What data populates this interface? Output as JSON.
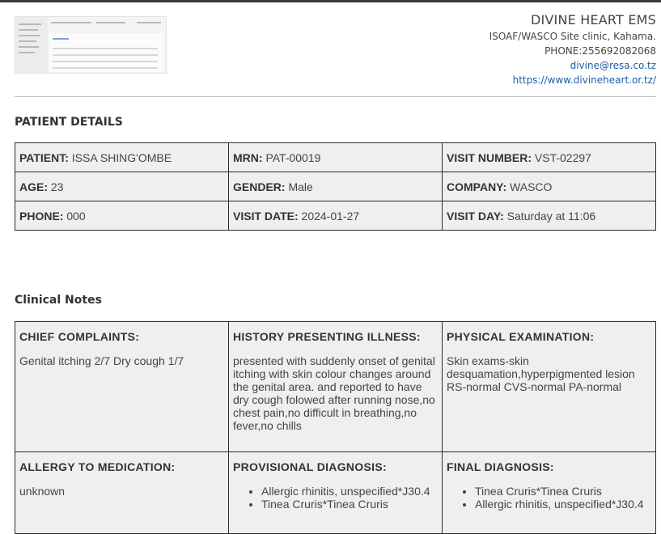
{
  "header": {
    "org_name": "DIVINE HEART EMS",
    "site": "ISOAF/WASCO Site clinic, Kahama.",
    "phone": "PHONE:255692082068",
    "email": "divine@resa.co.tz",
    "website": "https://www.divineheart.or.tz/"
  },
  "patient_details": {
    "title": "PATIENT DETAILS",
    "rows": [
      [
        {
          "label": "PATIENT:",
          "value": "ISSA SHING'OMBE"
        },
        {
          "label": "MRN:",
          "value": "PAT-00019"
        },
        {
          "label": "VISIT NUMBER:",
          "value": "VST-02297"
        }
      ],
      [
        {
          "label": "AGE:",
          "value": "23"
        },
        {
          "label": "GENDER:",
          "value": "Male"
        },
        {
          "label": "COMPANY:",
          "value": "WASCO"
        }
      ],
      [
        {
          "label": "PHONE:",
          "value": "000"
        },
        {
          "label": "VISIT DATE:",
          "value": "2024-01-27"
        },
        {
          "label": "VISIT DAY:",
          "value": "Saturday at 11:06"
        }
      ]
    ]
  },
  "clinical_notes": {
    "title": "Clinical Notes",
    "chief_complaints": {
      "label": "CHIEF COMPLAINTS:",
      "text": "Genital itching 2/7 Dry cough 1/7"
    },
    "history": {
      "label": "HISTORY PRESENTING ILLNESS:",
      "text": "presented with suddenly onset of genital itching with skin colour changes around the genital area. and reported to have dry cough folowed after running nose,no chest pain,no difficult in breathing,no fever,no chills"
    },
    "physical_exam": {
      "label": "PHYSICAL EXAMINATION:",
      "text": "Skin exams-skin desquamation,hyperpigmented lesion RS-normal CVS-normal PA-normal"
    },
    "allergy": {
      "label": "ALLERGY TO MEDICATION:",
      "text": "unknown"
    },
    "provisional_diagnosis": {
      "label": "PROVISIONAL DIAGNOSIS:",
      "items": [
        "Allergic rhinitis, unspecified*J30.4",
        "Tinea Cruris*Tinea Cruris"
      ]
    },
    "final_diagnosis": {
      "label": "FINAL DIAGNOSIS:",
      "items": [
        "Tinea Cruris*Tinea Cruris",
        "Allergic rhinitis, unspecified*J30.4"
      ]
    }
  }
}
